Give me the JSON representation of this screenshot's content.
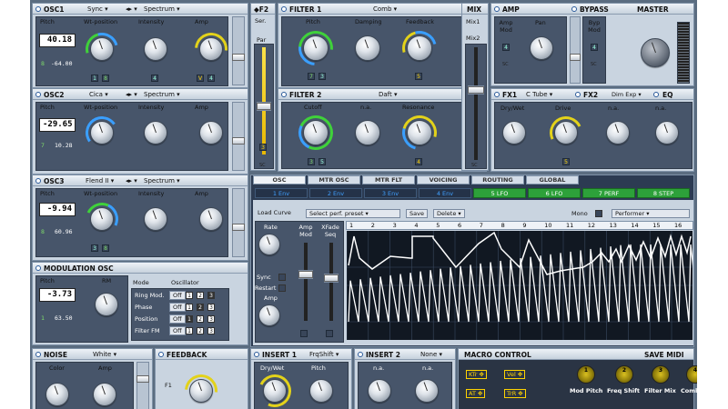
{
  "osc1": {
    "title": "OSC1",
    "sync": "Sync",
    "mode": "Spectrum",
    "labels": [
      "Pitch",
      "Wt-position",
      "Intensity",
      "Amp"
    ],
    "display": "40.18",
    "sub_a": "8",
    "sub_b": "-64.00",
    "boxes": [
      "1",
      "8",
      "4",
      "V",
      "4"
    ]
  },
  "osc2": {
    "title": "OSC2",
    "wave": "Cica",
    "mode": "Spectrum",
    "labels": [
      "Pitch",
      "Wt-position",
      "Intensity",
      "Amp"
    ],
    "display": "-29.65",
    "sub_a": "7",
    "sub_b": "10.28"
  },
  "osc3": {
    "title": "OSC3",
    "wave": "Flend II",
    "mode": "Spectrum",
    "labels": [
      "Pitch",
      "Wt-position",
      "Intensity",
      "Amp"
    ],
    "display": "-9.94",
    "sub_a": "8",
    "sub_b": "60.96",
    "boxes": [
      "3",
      "8"
    ]
  },
  "mod_osc": {
    "title": "MODULATION OSC",
    "labels": [
      "Pitch",
      "RM"
    ],
    "display": "-3.73",
    "sub_a": "1",
    "sub_b": "63.50",
    "col_mode": "Mode",
    "col_osc": "Oscillator",
    "rows": [
      "Ring Mod.",
      "Phase",
      "Position",
      "Filter FM"
    ],
    "off": "Off",
    "nums": [
      "1",
      "2",
      "3"
    ]
  },
  "f2": {
    "title": "F2",
    "ser": "Ser.",
    "par": "Par",
    "box": "3"
  },
  "filter1": {
    "title": "FILTER 1",
    "type": "Comb",
    "labels": [
      "Pitch",
      "Damping",
      "Feedback"
    ],
    "boxes": [
      "7",
      "3",
      "5"
    ]
  },
  "filter2": {
    "title": "FILTER 2",
    "type": "Daft",
    "labels": [
      "Cutoff",
      "n.a.",
      "Resonance"
    ],
    "boxes": [
      "3",
      "5",
      "4"
    ]
  },
  "mix": {
    "title": "MIX",
    "mix1": "Mix1",
    "mix2": "Mix2"
  },
  "amp": {
    "title": "AMP",
    "labels": [
      "Amp Mod",
      "Pan"
    ],
    "box": "4"
  },
  "bypass": {
    "title": "BYPASS",
    "labels": [
      "Byp Mod"
    ],
    "box": "4"
  },
  "master": {
    "title": "MASTER"
  },
  "fx1": {
    "title": "FX1",
    "type": "C Tube",
    "labels": [
      "Dry/Wet",
      "Drive",
      "n.a.",
      "n.a."
    ],
    "box": "5"
  },
  "fx2": {
    "title": "FX2",
    "type": "Dim Exp"
  },
  "eq": {
    "title": "EQ"
  },
  "tabs": [
    "OSC",
    "MTR OSC",
    "MTR FLT",
    "VOICING",
    "ROUTING",
    "GLOBAL"
  ],
  "envs": [
    "1 Env",
    "2 Env",
    "3 Env",
    "4 Env",
    "5 LFO",
    "6 LFO",
    "7 PERF",
    "8 STEP"
  ],
  "perf": {
    "load": "Load Curve",
    "select": "Select perf. preset",
    "save": "Save",
    "delete": "Delete",
    "mono": "Mono",
    "performer": "Performer",
    "rate": "Rate",
    "sync": "Sync",
    "restart": "Restart",
    "amp": "Amp",
    "amp_mod": "Amp Mod",
    "xfade": "XFade Seq",
    "steps": [
      "1",
      "2",
      "3",
      "4",
      "5",
      "6",
      "7",
      "8",
      "9",
      "10",
      "11",
      "12",
      "13",
      "14",
      "15",
      "16"
    ]
  },
  "noise": {
    "title": "NOISE",
    "type": "White",
    "labels": [
      "Color",
      "Amp"
    ]
  },
  "feedback": {
    "title": "FEEDBACK",
    "label": "F1"
  },
  "insert1": {
    "title": "INSERT 1",
    "type": "FrqShift",
    "labels": [
      "Dry/Wet",
      "Pitch"
    ]
  },
  "insert2": {
    "title": "INSERT 2",
    "type": "None",
    "labels": [
      "n.a.",
      "n.a."
    ]
  },
  "macro": {
    "title": "MACRO CONTROL",
    "save": "SAVE MIDI",
    "icons": [
      "KTr",
      "Vel",
      "AT",
      "TrR"
    ],
    "knobs": [
      "1",
      "2",
      "3",
      "4"
    ],
    "labels": [
      "Mod Pitch",
      "Freq Shift",
      "Filter Mix",
      "CombFeed"
    ]
  },
  "sc": "SC"
}
